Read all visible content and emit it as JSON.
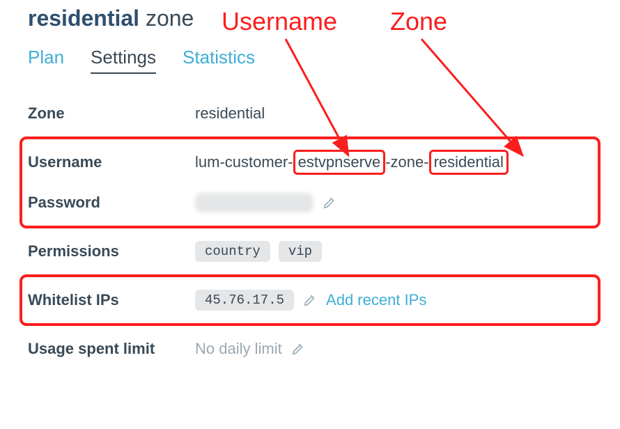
{
  "page_title": {
    "bold": "residential",
    "rest": " zone"
  },
  "tabs": {
    "plan": "Plan",
    "settings": "Settings",
    "statistics": "Statistics"
  },
  "rows": {
    "zone": {
      "label": "Zone",
      "value": "residential"
    },
    "username": {
      "label": "Username",
      "prefix": "lum-customer-",
      "customer": "estvpnserve",
      "mid": "-zone-",
      "zone": "residential"
    },
    "password": {
      "label": "Password"
    },
    "permissions": {
      "label": "Permissions",
      "p1": "country",
      "p2": "vip"
    },
    "whitelist": {
      "label": "Whitelist IPs",
      "ip": "45.76.17.5",
      "add": "Add recent IPs"
    },
    "usagelimit": {
      "label": "Usage spent limit",
      "value": "No daily limit"
    }
  },
  "annotations": {
    "username": "Username",
    "zone": "Zone"
  }
}
